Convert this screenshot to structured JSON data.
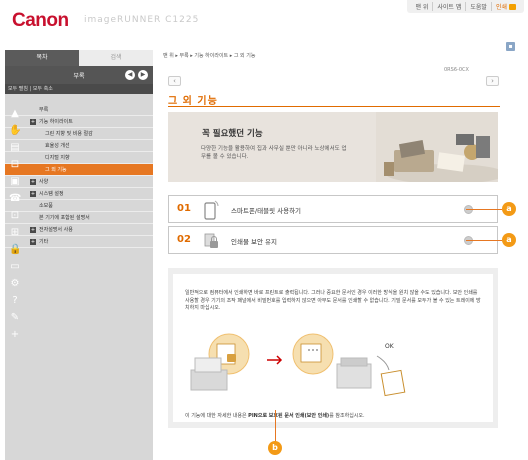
{
  "header": {
    "logo": "Canon",
    "product": "imageRUNNER C1225",
    "links": [
      "맨 위",
      "사이트 맵",
      "도움말",
      "인쇄"
    ]
  },
  "sidebar": {
    "tabs": [
      "목차",
      "검색"
    ],
    "section_title": "부록",
    "collapse_label": "모두 펼침 | 모두 축소",
    "tree": [
      {
        "label": "부록",
        "level": "l2b",
        "plus": false
      },
      {
        "label": "기능 하이라이트",
        "level": "l1",
        "plus": true
      },
      {
        "label": "그린 지향 및 비용 절감",
        "level": "l2",
        "plus": false
      },
      {
        "label": "효율성 개선",
        "level": "l2",
        "plus": false
      },
      {
        "label": "디지털 지향",
        "level": "l2",
        "plus": false
      },
      {
        "label": "그 외 기능",
        "level": "l2",
        "plus": false,
        "active": true
      },
      {
        "label": "사양",
        "level": "l0",
        "plus": true
      },
      {
        "label": "시스템 설정",
        "level": "l0",
        "plus": true
      },
      {
        "label": "소모품",
        "level": "l2b",
        "plus": false
      },
      {
        "label": "본 기기에 포함된 설명서",
        "level": "l2b",
        "plus": false
      },
      {
        "label": "전자설명서 사용",
        "level": "l0",
        "plus": true
      },
      {
        "label": "기타",
        "level": "l0",
        "plus": true
      }
    ],
    "icons": [
      "warning-icon",
      "hand-icon",
      "doc-icon",
      "printer-icon",
      "copy-icon",
      "fax-icon",
      "scan-icon",
      "network-icon",
      "lock-icon",
      "monitor-icon",
      "gear-icon",
      "help-icon",
      "wrench-icon",
      "plus-icon"
    ]
  },
  "main": {
    "breadcrumb": "맨 위 ▸ 부록 ▸ 기능 하이라이트 ▸ 그 외 기능",
    "doc_id": "0RS6-0CX",
    "page_title": "그 외 기능",
    "banner": {
      "title": "꼭 필요했던 기능",
      "description": "다양한 기능을 활용하여 집과 사무실 뿐만 아니라 노상에서도 업무를 볼 수 있습니다."
    },
    "items": [
      {
        "num": "01",
        "label": "스마트폰/태블릿 사용하기"
      },
      {
        "num": "02",
        "label": "인쇄물 보안 유지"
      }
    ],
    "detail": {
      "text": "일반적으로 컴퓨터에서 인쇄하면 바로 프린트로 출력됩니다. 그러나 중요한 문서인 경우 이러한 방식을 원치 않을 수도 있습니다. 보안 인쇄를 사용할 경우 기기의 조작 패널에서 비밀번호를 입력하지 않으면 아무도 문서를 인쇄할 수 없습니다. 기밀 문서를 모두가 볼 수 있는 트레이에 방치하지 마십시오.",
      "ok_label": "OK",
      "footer_prefix": "이 기능에 대한 자세한 내용은 ",
      "footer_link": "PIN으로 보호된 문서 인쇄(보안 인쇄)",
      "footer_suffix": "를 참조하십시오."
    },
    "callouts": [
      "a",
      "a",
      "b"
    ]
  },
  "colors": {
    "accent": "#e06b00",
    "logo": "#c8102e",
    "callout": "#f39a16"
  }
}
